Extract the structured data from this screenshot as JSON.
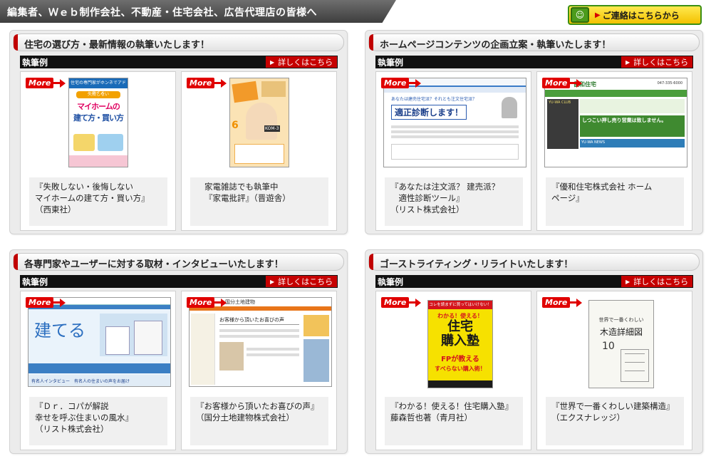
{
  "header": {
    "title": "編集者、Ｗｅｂ制作会社、不動産・住宅会社、広告代理店の皆様へ",
    "contact_label": "ご連絡はこちらから"
  },
  "common": {
    "example_label": "執筆例",
    "detail_label": "詳しくはこちら",
    "more_label": "More"
  },
  "panels": [
    {
      "title": "住宅の選び方・最新情報の執筆いたします！",
      "cards": [
        {
          "lines": [
            "『失敗しない・後悔しない",
            "マイホームの建て方・買い方』",
            "（西東社）"
          ],
          "thumb_text": [
            "住宅の専門家がホンネでアドバイス",
            "失敗しない",
            "マイホームの",
            "建て方・買い方"
          ]
        },
        {
          "lines": [
            "家電雑誌でも執筆中",
            "『家電批評』（晋遊舎）"
          ],
          "thumb_text": [
            "6",
            "KOM-3"
          ]
        }
      ]
    },
    {
      "title": "ホームページコンテンツの企画立案・執筆いたします！",
      "cards": [
        {
          "lines": [
            "『あなたは注文派？ 建売派？",
            "　適性診断ツール』",
            "（リスト株式会社）"
          ],
          "thumb_text": [
            "あなたは建売住宅派？それとも注文住宅派？",
            "適正診断します！"
          ]
        },
        {
          "lines": [
            "『優和住宅株式会社 ホーム",
            "ページ』"
          ],
          "thumb_text": [
            "優和住宅",
            "YU-WA CLUB",
            "しつこい押し売り営業は致しません。",
            "YU-WA NEWS",
            "047-335-6000"
          ]
        }
      ]
    },
    {
      "title": "各専門家やユーザーに対する取材・インタビューいたします！",
      "cards": [
        {
          "lines": [
            "『Ｄｒ．コパが解説",
            "幸せを呼ぶ住まいの風水』",
            "（リスト株式会社）"
          ],
          "thumb_text": [
            "建てる",
            "有名人インタビュー　有名人の住まいの声をお届け"
          ]
        },
        {
          "lines": [
            "『お客様から頂いたお喜びの声』",
            "（国分土地建物株式会社）"
          ],
          "thumb_text": [
            "国分土地建物",
            "お客様から頂いたお喜びの声"
          ]
        }
      ]
    },
    {
      "title": "ゴーストライティング・リライトいたします！",
      "cards": [
        {
          "lines": [
            "『わかる！使える！住宅購入塾』",
            "藤森哲也著（青月社）"
          ],
          "thumb_text": [
            "コレを読まずに買ってはいけない！",
            "わかる！使える！",
            "住宅",
            "購入塾",
            "FPが教える",
            "すべらない購入術！"
          ]
        },
        {
          "lines": [
            "『世界で一番くわしい建築構造』",
            "（エクスナレッジ）"
          ],
          "thumb_text": [
            "世界で一番くわしい",
            "木造詳細図",
            "10"
          ]
        }
      ]
    }
  ]
}
